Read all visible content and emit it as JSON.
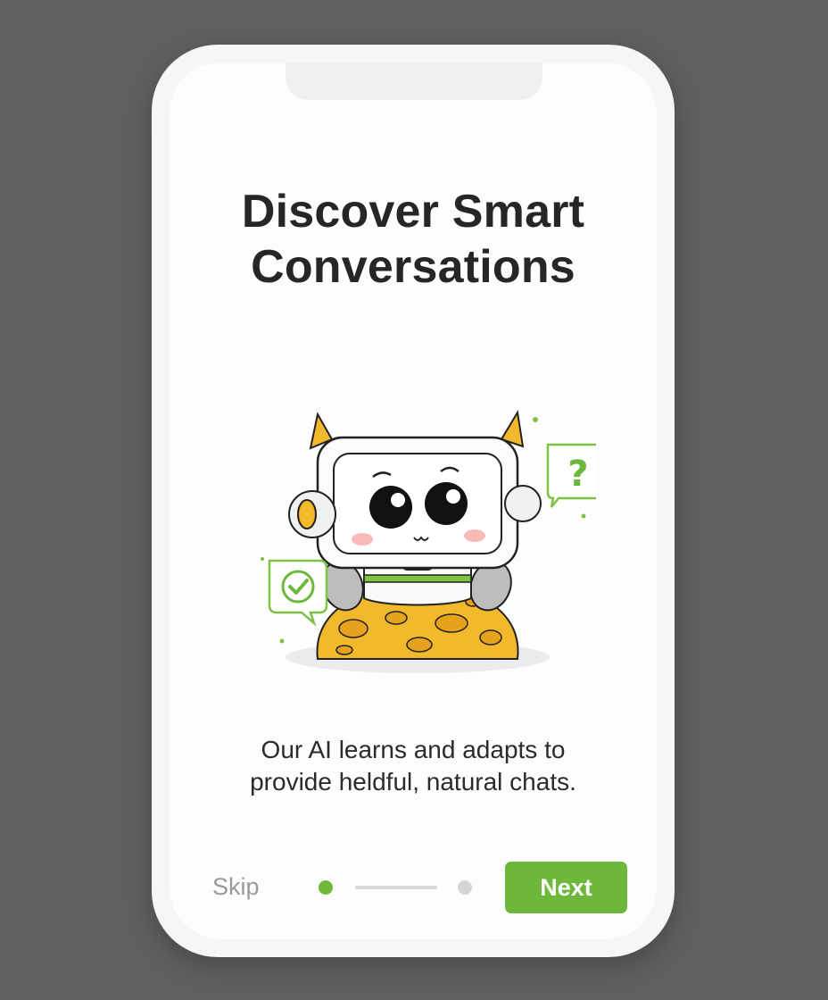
{
  "onboarding": {
    "title": "Discover Smart Conversations",
    "subtitle": "Our AI learns and adapts to provide heldful, natural chats.",
    "skip_label": "Skip",
    "next_label": "Next",
    "step": {
      "current": 1,
      "total": 2
    }
  },
  "illustration": {
    "icons": [
      "robot-mascot",
      "question-bubble-icon",
      "check-bubble-icon",
      "moon-rock"
    ]
  },
  "colors": {
    "accent": "#6db83a",
    "title": "#262626",
    "background": "#5f6062"
  }
}
